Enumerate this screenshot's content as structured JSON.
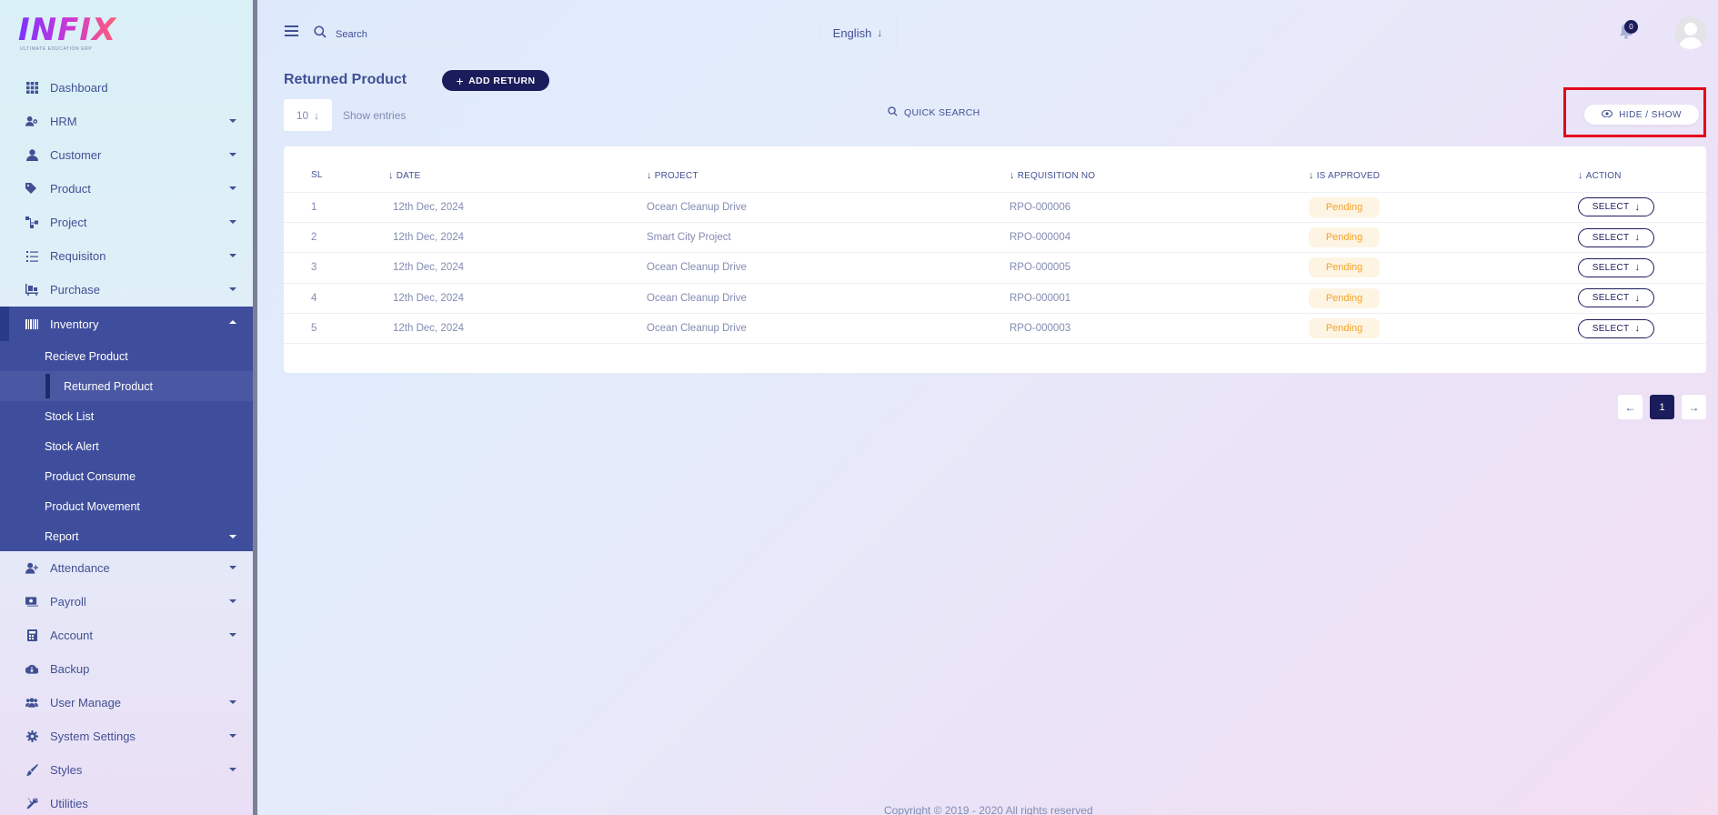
{
  "brand": {
    "logo_text": "INFIX",
    "logo_subtitle": "ULTIMATE EDUCATION ERP"
  },
  "sidebar": {
    "items": [
      {
        "label": "Dashboard",
        "icon": "dashboard-icon"
      },
      {
        "label": "HRM",
        "icon": "hrm-icon"
      },
      {
        "label": "Customer",
        "icon": "customer-icon"
      },
      {
        "label": "Product",
        "icon": "tag-icon"
      },
      {
        "label": "Project",
        "icon": "project-icon"
      },
      {
        "label": "Requisiton",
        "icon": "list-icon"
      },
      {
        "label": "Purchase",
        "icon": "purchase-icon"
      },
      {
        "label": "Inventory",
        "icon": "inventory-icon"
      },
      {
        "label": "Attendance",
        "icon": "attendance-icon"
      },
      {
        "label": "Payroll",
        "icon": "payroll-icon"
      },
      {
        "label": "Account",
        "icon": "calculator-icon"
      },
      {
        "label": "Backup",
        "icon": "cloud-download-icon"
      },
      {
        "label": "User Manage",
        "icon": "users-icon"
      },
      {
        "label": "System Settings",
        "icon": "gear-icon"
      },
      {
        "label": "Styles",
        "icon": "brush-icon"
      },
      {
        "label": "Utilities",
        "icon": "tools-icon"
      }
    ],
    "inventory_sub": [
      {
        "label": "Recieve Product"
      },
      {
        "label": "Returned Product"
      },
      {
        "label": "Stock List"
      },
      {
        "label": "Stock Alert"
      },
      {
        "label": "Product Consume"
      },
      {
        "label": "Product Movement"
      },
      {
        "label": "Report"
      }
    ]
  },
  "topbar": {
    "search_placeholder": "Search",
    "language": "English",
    "notification_count": "0"
  },
  "page": {
    "title": "Returned Product",
    "add_button": "ADD RETURN",
    "entries_value": "10",
    "entries_label": "Show entries",
    "quick_search": "QUICK SEARCH",
    "hide_show": "HIDE / SHOW"
  },
  "table": {
    "headers": {
      "sl": "SL",
      "date": "DATE",
      "project": "PROJECT",
      "requisition": "REQUISITION NO",
      "approved": "IS APPROVED",
      "action": "ACTION"
    },
    "rows": [
      {
        "sl": "1",
        "date": "12th Dec, 2024",
        "project": "Ocean Cleanup Drive",
        "requisition": "RPO-000006",
        "approved": "Pending",
        "action": "SELECT"
      },
      {
        "sl": "2",
        "date": "12th Dec, 2024",
        "project": "Smart City Project",
        "requisition": "RPO-000004",
        "approved": "Pending",
        "action": "SELECT"
      },
      {
        "sl": "3",
        "date": "12th Dec, 2024",
        "project": "Ocean Cleanup Drive",
        "requisition": "RPO-000005",
        "approved": "Pending",
        "action": "SELECT"
      },
      {
        "sl": "4",
        "date": "12th Dec, 2024",
        "project": "Ocean Cleanup Drive",
        "requisition": "RPO-000001",
        "approved": "Pending",
        "action": "SELECT"
      },
      {
        "sl": "5",
        "date": "12th Dec, 2024",
        "project": "Ocean Cleanup Drive",
        "requisition": "RPO-000003",
        "approved": "Pending",
        "action": "SELECT"
      }
    ]
  },
  "pagination": {
    "current": "1"
  },
  "footer": {
    "text": "Copyright © 2019 - 2020 All rights reserved"
  },
  "colors": {
    "primary": "#1b1c5c",
    "sidebar_active": "#3f4e9c",
    "text": "#415094",
    "muted": "#828bb2",
    "pending": "#f7a325",
    "highlight": "#e6001c"
  }
}
